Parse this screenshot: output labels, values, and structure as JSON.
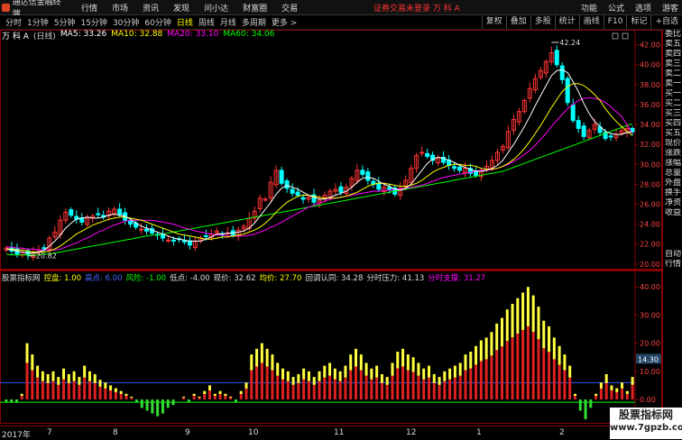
{
  "menubar": {
    "app_name": "通达信金融终端",
    "items": [
      "行情",
      "市场",
      "资讯",
      "发现",
      "问小达",
      "财富圈",
      "交易"
    ],
    "alert": "证券交易未登录 万 科 A",
    "right_items": [
      "功能",
      "公式",
      "选项",
      "游客"
    ]
  },
  "toolbar": {
    "periods": [
      "分时",
      "1分钟",
      "5分钟",
      "15分钟",
      "30分钟",
      "60分钟",
      "日线",
      "周线",
      "月线",
      "多周期",
      "更多 >"
    ],
    "active_period": "日线",
    "right_buttons": [
      "复权",
      "叠加",
      "多股",
      "统计",
      "画线",
      "F10",
      "标记",
      "+自选"
    ]
  },
  "main_legend": {
    "stock": "万 科 A",
    "period": "(日线)",
    "ma": [
      {
        "label": "MA5: 33.26",
        "color": "#ffffff"
      },
      {
        "label": "MA10: 32.88",
        "color": "#ffff00"
      },
      {
        "label": "MA20: 33.10",
        "color": "#ff00ff"
      },
      {
        "label": "MA60: 34.06",
        "color": "#00ff00"
      }
    ]
  },
  "price_axis": {
    "ticks": [
      "42.00",
      "40.00",
      "38.00",
      "36.00",
      "34.00",
      "32.00",
      "30.00",
      "28.00",
      "26.00",
      "24.00",
      "22.00",
      "20.00"
    ],
    "high_label": "42.24",
    "low_label": "20.82"
  },
  "price_series": {
    "close": [
      21.6,
      21.3,
      21.0,
      21.2,
      20.9,
      21.1,
      21.4,
      21.6,
      22.6,
      23.2,
      24.4,
      25.2,
      24.9,
      24.5,
      24.2,
      24.6,
      24.8,
      25.0,
      24.7,
      25.3,
      25.5,
      24.9,
      24.4,
      24.0,
      23.7,
      23.5,
      23.3,
      23.1,
      22.9,
      22.6,
      22.4,
      22.3,
      22.5,
      22.2,
      21.9,
      22.3,
      22.6,
      22.8,
      23.0,
      23.3,
      23.0,
      23.1,
      22.9,
      23.4,
      23.8,
      24.6,
      25.3,
      26.6,
      26.5,
      28.2,
      29.4,
      28.1,
      27.6,
      27.1,
      26.9,
      26.5,
      26.7,
      26.2,
      26.4,
      26.9,
      27.3,
      27.5,
      27.2,
      27.7,
      28.6,
      29.4,
      29.0,
      28.4,
      28.0,
      27.5,
      27.7,
      27.4,
      27.0,
      27.6,
      28.4,
      29.6,
      30.9,
      31.2,
      30.8,
      30.4,
      30.7,
      30.2,
      29.9,
      29.6,
      29.4,
      29.6,
      29.1,
      28.9,
      29.4,
      29.8,
      30.4,
      31.2,
      31.8,
      33.3,
      34.5,
      35.3,
      36.4,
      37.6,
      38.6,
      39.4,
      40.3,
      41.2,
      40.0,
      38.5,
      36.2,
      34.4,
      33.6,
      32.8,
      33.4,
      34.0,
      33.2,
      32.6,
      32.8,
      33.0,
      33.4,
      33.6,
      33.26
    ],
    "ma5": [
      21.5,
      21.4,
      21.3,
      21.2,
      21.1,
      21.1,
      21.2,
      21.4,
      21.8,
      22.3,
      22.9,
      23.6,
      24.1,
      24.5,
      24.6,
      24.7,
      24.6,
      24.6,
      24.7,
      24.9,
      25.0,
      24.9,
      24.8,
      24.5,
      24.1,
      23.8,
      23.6,
      23.4,
      23.2,
      23.0,
      22.8,
      22.6,
      22.5,
      22.4,
      22.3,
      22.3,
      22.3,
      22.5,
      22.7,
      23.0,
      23.0,
      23.1,
      23.1,
      23.2,
      23.3,
      23.6,
      24.1,
      24.8,
      25.5,
      26.2,
      27.0,
      27.6,
      27.9,
      27.7,
      27.5,
      27.2,
      26.9,
      26.7,
      26.5,
      26.5,
      26.7,
      26.9,
      27.1,
      27.3,
      27.7,
      28.2,
      28.6,
      28.7,
      28.6,
      28.3,
      28.0,
      27.8,
      27.5,
      27.4,
      27.6,
      28.0,
      28.7,
      29.4,
      30.1,
      30.5,
      30.7,
      30.6,
      30.4,
      30.2,
      29.9,
      29.7,
      29.5,
      29.3,
      29.3,
      29.4,
      29.6,
      29.9,
      30.4,
      31.2,
      32.0,
      32.9,
      33.8,
      34.8,
      35.9,
      36.9,
      37.9,
      38.9,
      39.4,
      39.5,
      39.2,
      38.3,
      37.3,
      36.1,
      35.1,
      34.3,
      33.8,
      33.3,
      33.1,
      33.0,
      33.0,
      33.2,
      33.26
    ],
    "ma10": [
      21.5,
      21.5,
      21.4,
      21.4,
      21.3,
      21.2,
      21.2,
      21.2,
      21.3,
      21.5,
      21.8,
      22.2,
      22.6,
      23.0,
      23.3,
      23.6,
      23.9,
      24.1,
      24.3,
      24.5,
      24.6,
      24.7,
      24.7,
      24.6,
      24.5,
      24.4,
      24.2,
      24.0,
      23.8,
      23.6,
      23.4,
      23.2,
      23.0,
      22.9,
      22.8,
      22.7,
      22.6,
      22.5,
      22.5,
      22.6,
      22.7,
      22.7,
      22.8,
      22.9,
      23.0,
      23.2,
      23.4,
      23.7,
      24.1,
      24.6,
      25.2,
      25.7,
      26.2,
      26.5,
      26.8,
      26.9,
      26.9,
      26.8,
      26.7,
      26.6,
      26.6,
      26.6,
      26.7,
      26.8,
      27.0,
      27.2,
      27.5,
      27.8,
      28.0,
      28.1,
      28.1,
      28.0,
      27.9,
      27.8,
      27.8,
      27.9,
      28.1,
      28.4,
      28.8,
      29.2,
      29.5,
      29.7,
      29.9,
      30.0,
      30.0,
      29.9,
      29.9,
      29.8,
      29.6,
      29.5,
      29.5,
      29.6,
      29.8,
      30.1,
      30.5,
      31.0,
      31.6,
      32.3,
      33.1,
      33.9,
      34.8,
      35.7,
      36.5,
      37.3,
      37.8,
      38.1,
      38.1,
      37.9,
      37.5,
      37.0,
      36.4,
      35.6,
      34.9,
      34.3,
      33.8,
      33.3,
      32.88
    ],
    "ma20": [
      21.7,
      21.7,
      21.6,
      21.6,
      21.5,
      21.5,
      21.4,
      21.4,
      21.4,
      21.4,
      21.5,
      21.7,
      21.9,
      22.1,
      22.4,
      22.6,
      22.9,
      23.2,
      23.4,
      23.7,
      23.9,
      24.1,
      24.3,
      24.4,
      24.4,
      24.4,
      24.4,
      24.4,
      24.3,
      24.2,
      24.1,
      24.0,
      23.8,
      23.6,
      23.5,
      23.3,
      23.2,
      23.1,
      23.0,
      22.9,
      22.9,
      22.8,
      22.8,
      22.8,
      22.8,
      22.9,
      23.0,
      23.2,
      23.4,
      23.7,
      23.9,
      24.2,
      24.5,
      24.8,
      25.1,
      25.4,
      25.7,
      25.9,
      26.1,
      26.3,
      26.5,
      26.6,
      26.7,
      26.8,
      26.9,
      27.0,
      27.1,
      27.2,
      27.3,
      27.3,
      27.4,
      27.4,
      27.5,
      27.5,
      27.6,
      27.7,
      27.8,
      27.9,
      28.1,
      28.3,
      28.5,
      28.7,
      28.8,
      28.9,
      29.0,
      29.1,
      29.2,
      29.3,
      29.4,
      29.4,
      29.5,
      29.6,
      29.8,
      30.0,
      30.3,
      30.6,
      31.0,
      31.4,
      31.9,
      32.5,
      33.1,
      33.8,
      34.4,
      35.0,
      35.6,
      36.0,
      36.4,
      36.6,
      36.7,
      36.6,
      36.5,
      36.2,
      35.8,
      35.3,
      34.8,
      34.0,
      33.1
    ],
    "ma60": [
      21.0,
      20.9,
      20.9,
      20.9,
      20.9,
      20.9,
      20.9,
      21.0,
      21.0,
      21.1,
      21.2,
      21.3,
      21.4,
      21.5,
      21.6,
      21.7,
      21.8,
      21.9,
      22.0,
      22.1,
      22.2,
      22.3,
      22.4,
      22.5,
      22.6,
      22.7,
      22.8,
      22.9,
      22.9,
      23.0,
      23.1,
      23.2,
      23.3,
      23.4,
      23.5,
      23.6,
      23.7,
      23.8,
      23.9,
      24.0,
      24.1,
      24.2,
      24.3,
      24.4,
      24.5,
      24.6,
      24.7,
      24.8,
      24.9,
      25.0,
      25.1,
      25.2,
      25.3,
      25.4,
      25.5,
      25.6,
      25.7,
      25.8,
      25.9,
      26.0,
      26.1,
      26.2,
      26.3,
      26.4,
      26.5,
      26.6,
      26.7,
      26.8,
      26.9,
      27.0,
      27.1,
      27.2,
      27.3,
      27.4,
      27.5,
      27.6,
      27.7,
      27.8,
      27.9,
      28.0,
      28.1,
      28.2,
      28.3,
      28.4,
      28.5,
      28.6,
      28.7,
      28.8,
      28.9,
      29.0,
      29.1,
      29.2,
      29.3,
      29.5,
      29.7,
      29.9,
      30.1,
      30.3,
      30.5,
      30.7,
      30.9,
      31.1,
      31.3,
      31.5,
      31.7,
      31.9,
      32.1,
      32.3,
      32.5,
      32.7,
      32.9,
      33.1,
      33.3,
      33.5,
      33.7,
      33.9,
      34.06
    ]
  },
  "sub_legend": [
    {
      "label": "股票指标网",
      "color": "#dddddd"
    },
    {
      "label": "控盘: 1.00",
      "color": "#ffff00"
    },
    {
      "label": "高点: 6.00",
      "color": "#4466ff"
    },
    {
      "label": "风险: -1.00",
      "color": "#00ff00"
    },
    {
      "label": "低点: -4.00",
      "color": "#dddddd"
    },
    {
      "label": "现价: 32.62",
      "color": "#dddddd"
    },
    {
      "label": "均价: 27.70",
      "color": "#ffff00"
    },
    {
      "label": "回调认同: 34.28",
      "color": "#dddddd"
    },
    {
      "label": "分时压力: 41.13",
      "color": "#dddddd"
    },
    {
      "label": "分时支撑: 31.27",
      "color": "#ff00ff"
    }
  ],
  "sub_axis": {
    "ticks": [
      "40.00",
      "30.00",
      "20.00",
      "10.00",
      "0.00"
    ],
    "current": "14.30"
  },
  "sub_series": {
    "values": [
      -1,
      -1,
      -1,
      2,
      20,
      16,
      12,
      10,
      9,
      10,
      8,
      11,
      9,
      10,
      8,
      12,
      10,
      9,
      7,
      6,
      5,
      4,
      3,
      2,
      1,
      -1,
      -3,
      -4,
      -5,
      -6,
      -5,
      -3,
      -2,
      0,
      1,
      -1,
      2,
      1,
      3,
      5,
      2,
      3,
      2,
      1,
      -1,
      3,
      6,
      16,
      18,
      20,
      18,
      16,
      13,
      11,
      10,
      8,
      9,
      11,
      10,
      8,
      10,
      12,
      13,
      11,
      10,
      12,
      16,
      18,
      16,
      13,
      11,
      12,
      9,
      8,
      13,
      17,
      18,
      16,
      15,
      13,
      11,
      12,
      9,
      8,
      10,
      11,
      12,
      13,
      16,
      17,
      19,
      21,
      22,
      24,
      27,
      29,
      32,
      34,
      36,
      38,
      40,
      37,
      33,
      28,
      26,
      22,
      19,
      16,
      12,
      2,
      -4,
      -7,
      -3,
      2,
      6,
      9,
      5,
      4,
      6,
      3,
      8
    ],
    "blue_line": 6,
    "green_line": -1
  },
  "dates": [
    "2017年",
    "7",
    "8",
    "9",
    "10",
    "11",
    "12",
    "1",
    "2"
  ],
  "sidebar": [
    "委比",
    "卖五",
    "卖四",
    "卖三",
    "卖二",
    "卖一",
    "买一",
    "买二",
    "买三",
    "买四",
    "买五",
    "现价",
    "涨跌",
    "涨幅",
    "总量",
    "外盘",
    "换手",
    "净资",
    "收益",
    "",
    "自动",
    "行情"
  ],
  "watermark": {
    "line1": "股票指标网",
    "line2": "www.7gpzb.com"
  },
  "colors": {
    "up": "#ff3333",
    "down": "#00ffff",
    "frame": "#880000",
    "bg": "#000000"
  }
}
